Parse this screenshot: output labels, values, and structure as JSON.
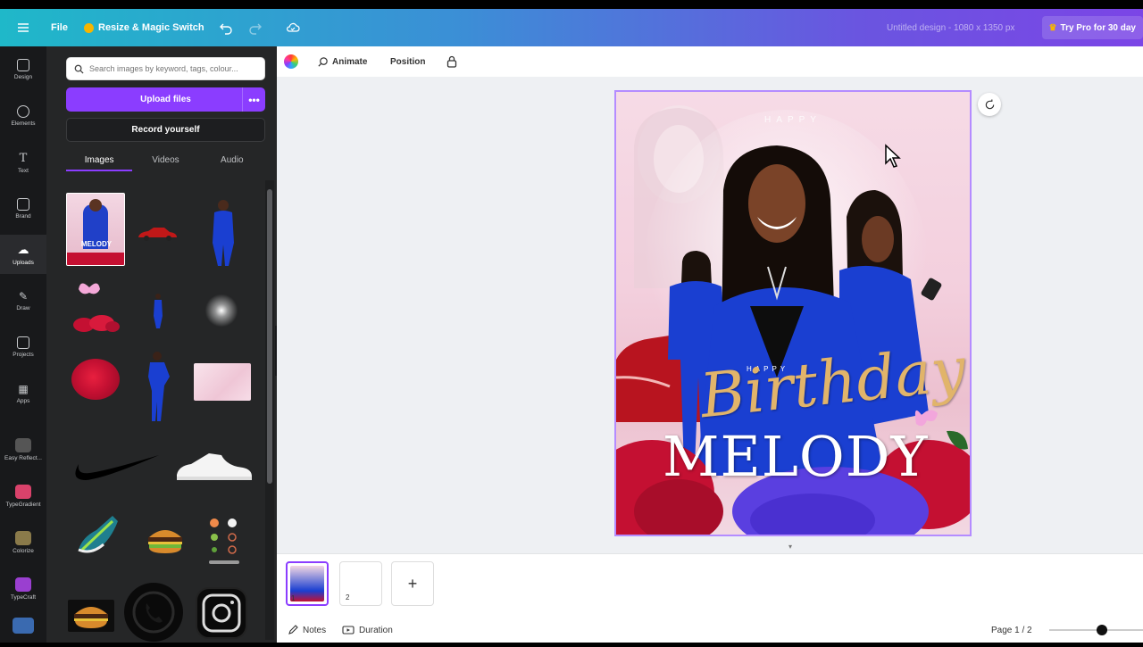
{
  "topbar": {
    "file_label": "File",
    "resize_label": "Resize & Magic Switch",
    "doc_title": "Untitled design - 1080 x 1350 px",
    "try_pro_label": "Try Pro for 30 day"
  },
  "rail": {
    "items": [
      {
        "label": "Design"
      },
      {
        "label": "Elements"
      },
      {
        "label": "Text"
      },
      {
        "label": "Brand"
      },
      {
        "label": "Uploads"
      },
      {
        "label": "Draw"
      },
      {
        "label": "Projects"
      },
      {
        "label": "Apps"
      },
      {
        "label": "Easy Reflect..."
      },
      {
        "label": "TypeGradient"
      },
      {
        "label": "Colorize"
      },
      {
        "label": "TypeCraft"
      }
    ]
  },
  "panel": {
    "search_placeholder": "Search images by keyword, tags, colour...",
    "upload_label": "Upload files",
    "upload_more": "•••",
    "record_label": "Record yourself",
    "tabs": [
      "Images",
      "Videos",
      "Audio"
    ],
    "thumbnails": [
      "birthday poster",
      "red car",
      "woman blue suit",
      "butterfly roses",
      "small figure",
      "glow light",
      "red rose",
      "woman walking",
      "pink texture",
      "nike swoosh",
      "white sneaker",
      "running shoe",
      "burger",
      "sticker set",
      "burger",
      "whatsapp logo",
      "instagram logo"
    ]
  },
  "toolbar": {
    "animate_label": "Animate",
    "position_label": "Position"
  },
  "design": {
    "top_text": "HAPPY",
    "happy_text": "HAPPY",
    "birthday_text": "Birthday",
    "name_text": "MELODY"
  },
  "pages": {
    "page1_num": "1",
    "page2_num": "2",
    "add_label": "+"
  },
  "status": {
    "notes_label": "Notes",
    "duration_label": "Duration",
    "page_indicator": "Page 1 / 2"
  },
  "colors": {
    "accent": "#8b3dff",
    "suit_blue": "#1a3fd1",
    "rose_red": "#c41032"
  }
}
